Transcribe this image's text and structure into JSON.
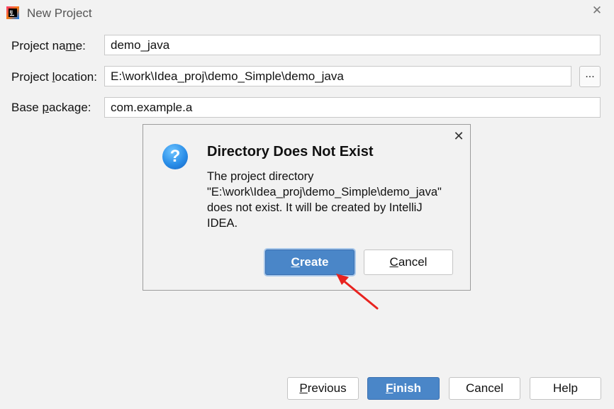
{
  "window": {
    "title": "New Project",
    "icon": "intellij-icon"
  },
  "form": {
    "project_name": {
      "label_pre": "Project na",
      "label_u": "m",
      "label_post": "e:",
      "value": "demo_java"
    },
    "project_location": {
      "label_pre": "Project ",
      "label_u": "l",
      "label_post": "ocation:",
      "value": "E:\\work\\Idea_proj\\demo_Simple\\demo_java",
      "browse_label": "..."
    },
    "base_package": {
      "label_pre": "Base ",
      "label_u": "p",
      "label_post": "ackage:",
      "value": "com.example.a"
    }
  },
  "dialog": {
    "title": "Directory Does Not Exist",
    "icon": "question-icon",
    "message_lines": [
      "The project directory",
      "\"E:\\work\\Idea_proj\\demo_Simple\\demo_java\"",
      "does not exist. It will be created by IntelliJ",
      "IDEA."
    ],
    "create_u": "C",
    "create_rest": "reate",
    "cancel_u": "C",
    "cancel_rest": "ancel"
  },
  "footer": {
    "previous_u": "P",
    "previous_rest": "revious",
    "finish_u": "F",
    "finish_rest": "inish",
    "cancel_label": "Cancel",
    "help_label": "Help"
  },
  "colors": {
    "primary_button": "#4a86c8",
    "annotation_arrow": "#e8231f",
    "question_icon": "#2a8ee8"
  }
}
